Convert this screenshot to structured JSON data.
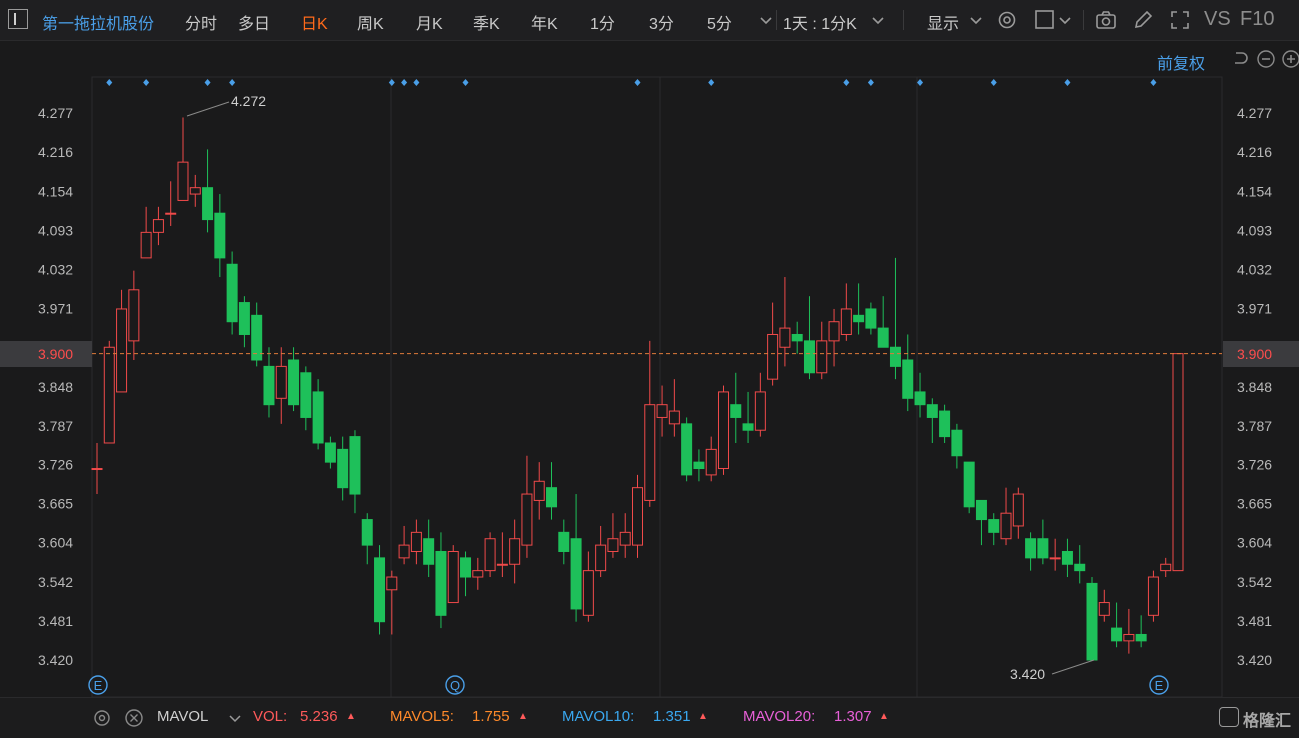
{
  "toolbar": {
    "stock_name": "第一拖拉机股份",
    "periods": [
      "分时",
      "多日",
      "日K",
      "周K",
      "月K",
      "季K",
      "年K",
      "1分",
      "3分",
      "5分"
    ],
    "active_period": "日K",
    "multi_period": "1天 : 1分K",
    "display_label": "显示",
    "vs_label": "VS",
    "f10_label": "F10",
    "accent_color": "#ff6a1a",
    "icons": [
      "chevron-down-icon",
      "gear-icon",
      "square-icon",
      "camera-icon",
      "pencil-icon",
      "fullscreen-icon"
    ]
  },
  "subbar": {
    "adjust_label": "前复权",
    "icons": [
      "undo-icon",
      "zoom-out-icon",
      "zoom-in-icon"
    ]
  },
  "chart_data": {
    "type": "candlestick",
    "price_ticks": [
      "4.277",
      "4.216",
      "4.154",
      "4.093",
      "4.032",
      "3.971",
      "3.900",
      "3.848",
      "3.787",
      "3.726",
      "3.665",
      "3.604",
      "3.542",
      "3.481",
      "3.420"
    ],
    "current_price": "3.900",
    "high_label": "4.272",
    "low_label": "3.420",
    "ylim": [
      3.39,
      4.3
    ],
    "up_color": "#f04a4a",
    "down_color": "#1ec05a",
    "ref_line_color": "#e07a3a",
    "event_badges": [
      "E",
      "Q",
      "E"
    ],
    "candles": [
      [
        3.72,
        3.72,
        3.68,
        3.76
      ],
      [
        3.76,
        3.91,
        3.76,
        3.92
      ],
      [
        3.84,
        3.97,
        3.88,
        4.0
      ],
      [
        3.92,
        4.0,
        3.89,
        4.03
      ],
      [
        4.05,
        4.09,
        4.06,
        4.13
      ],
      [
        4.09,
        4.11,
        4.07,
        4.13
      ],
      [
        4.12,
        4.12,
        4.1,
        4.17
      ],
      [
        4.14,
        4.2,
        4.14,
        4.27
      ],
      [
        4.15,
        4.16,
        4.13,
        4.18
      ],
      [
        4.16,
        4.11,
        4.09,
        4.22
      ],
      [
        4.12,
        4.05,
        4.02,
        4.15
      ],
      [
        4.04,
        3.95,
        3.93,
        4.06
      ],
      [
        3.98,
        3.93,
        3.91,
        3.99
      ],
      [
        3.96,
        3.89,
        3.88,
        3.98
      ],
      [
        3.88,
        3.82,
        3.8,
        3.91
      ],
      [
        3.83,
        3.88,
        3.79,
        3.91
      ],
      [
        3.89,
        3.82,
        3.81,
        3.91
      ],
      [
        3.87,
        3.8,
        3.78,
        3.88
      ],
      [
        3.84,
        3.76,
        3.75,
        3.86
      ],
      [
        3.76,
        3.73,
        3.72,
        3.77
      ],
      [
        3.75,
        3.69,
        3.67,
        3.77
      ],
      [
        3.77,
        3.68,
        3.65,
        3.78
      ],
      [
        3.64,
        3.6,
        3.57,
        3.65
      ],
      [
        3.58,
        3.48,
        3.46,
        3.6
      ],
      [
        3.53,
        3.55,
        3.46,
        3.56
      ],
      [
        3.58,
        3.6,
        3.57,
        3.63
      ],
      [
        3.59,
        3.62,
        3.57,
        3.64
      ],
      [
        3.61,
        3.57,
        3.55,
        3.64
      ],
      [
        3.59,
        3.49,
        3.47,
        3.62
      ],
      [
        3.51,
        3.59,
        3.51,
        3.6
      ],
      [
        3.58,
        3.55,
        3.52,
        3.59
      ],
      [
        3.55,
        3.56,
        3.53,
        3.58
      ],
      [
        3.56,
        3.61,
        3.55,
        3.62
      ],
      [
        3.57,
        3.57,
        3.55,
        3.62
      ],
      [
        3.57,
        3.61,
        3.54,
        3.64
      ],
      [
        3.6,
        3.68,
        3.58,
        3.74
      ],
      [
        3.67,
        3.7,
        3.64,
        3.73
      ],
      [
        3.69,
        3.66,
        3.64,
        3.73
      ],
      [
        3.62,
        3.59,
        3.57,
        3.64
      ],
      [
        3.61,
        3.5,
        3.48,
        3.68
      ],
      [
        3.49,
        3.56,
        3.48,
        3.59
      ],
      [
        3.56,
        3.6,
        3.55,
        3.63
      ],
      [
        3.59,
        3.61,
        3.58,
        3.65
      ],
      [
        3.6,
        3.62,
        3.58,
        3.65
      ],
      [
        3.6,
        3.69,
        3.58,
        3.71
      ],
      [
        3.67,
        3.82,
        3.66,
        3.92
      ],
      [
        3.8,
        3.82,
        3.77,
        3.85
      ],
      [
        3.79,
        3.81,
        3.77,
        3.86
      ],
      [
        3.79,
        3.71,
        3.7,
        3.8
      ],
      [
        3.73,
        3.72,
        3.7,
        3.75
      ],
      [
        3.71,
        3.75,
        3.7,
        3.77
      ],
      [
        3.72,
        3.84,
        3.71,
        3.85
      ],
      [
        3.82,
        3.8,
        3.76,
        3.87
      ],
      [
        3.79,
        3.78,
        3.76,
        3.84
      ],
      [
        3.78,
        3.84,
        3.77,
        3.87
      ],
      [
        3.86,
        3.93,
        3.85,
        3.98
      ],
      [
        3.91,
        3.94,
        3.88,
        4.02
      ],
      [
        3.93,
        3.92,
        3.9,
        3.95
      ],
      [
        3.92,
        3.87,
        3.86,
        3.99
      ],
      [
        3.87,
        3.92,
        3.86,
        3.95
      ],
      [
        3.92,
        3.95,
        3.88,
        3.97
      ],
      [
        3.93,
        3.97,
        3.92,
        4.01
      ],
      [
        3.96,
        3.95,
        3.93,
        4.01
      ],
      [
        3.97,
        3.94,
        3.93,
        3.98
      ],
      [
        3.94,
        3.91,
        3.92,
        3.99
      ],
      [
        3.91,
        3.88,
        3.86,
        4.05
      ],
      [
        3.89,
        3.83,
        3.81,
        3.93
      ],
      [
        3.84,
        3.82,
        3.8,
        3.87
      ],
      [
        3.82,
        3.8,
        3.76,
        3.83
      ],
      [
        3.81,
        3.77,
        3.76,
        3.82
      ],
      [
        3.78,
        3.74,
        3.72,
        3.79
      ],
      [
        3.73,
        3.66,
        3.65,
        3.73
      ],
      [
        3.67,
        3.64,
        3.6,
        3.67
      ],
      [
        3.64,
        3.62,
        3.6,
        3.65
      ],
      [
        3.61,
        3.65,
        3.6,
        3.69
      ],
      [
        3.63,
        3.68,
        3.61,
        3.69
      ],
      [
        3.61,
        3.58,
        3.56,
        3.62
      ],
      [
        3.61,
        3.58,
        3.57,
        3.64
      ],
      [
        3.58,
        3.58,
        3.56,
        3.61
      ],
      [
        3.59,
        3.57,
        3.55,
        3.61
      ],
      [
        3.57,
        3.56,
        3.54,
        3.6
      ],
      [
        3.54,
        3.42,
        3.42,
        3.55
      ],
      [
        3.49,
        3.51,
        3.48,
        3.53
      ],
      [
        3.47,
        3.45,
        3.44,
        3.51
      ],
      [
        3.45,
        3.46,
        3.43,
        3.5
      ],
      [
        3.46,
        3.45,
        3.44,
        3.49
      ],
      [
        3.49,
        3.55,
        3.48,
        3.56
      ],
      [
        3.56,
        3.57,
        3.55,
        3.58
      ],
      [
        3.56,
        3.9,
        3.56,
        3.9
      ]
    ],
    "top_markers": [
      1,
      4,
      9,
      11,
      24,
      25,
      26,
      30,
      44,
      50,
      61,
      63,
      67,
      73,
      79,
      86
    ]
  },
  "volume_bar": {
    "settings_icon": "gear-icon",
    "close_icon": "close-icon",
    "indicator": "MAVOL",
    "items": [
      {
        "label": "VOL:",
        "value": "5.236",
        "color": "#ff5a5a"
      },
      {
        "label": "MAVOL5:",
        "value": "1.755",
        "color": "#ff8a2a"
      },
      {
        "label": "MAVOL10:",
        "value": "1.351",
        "color": "#3aa8f0"
      },
      {
        "label": "MAVOL20:",
        "value": "1.307",
        "color": "#e860d8"
      }
    ],
    "watermark": "格隆汇"
  }
}
